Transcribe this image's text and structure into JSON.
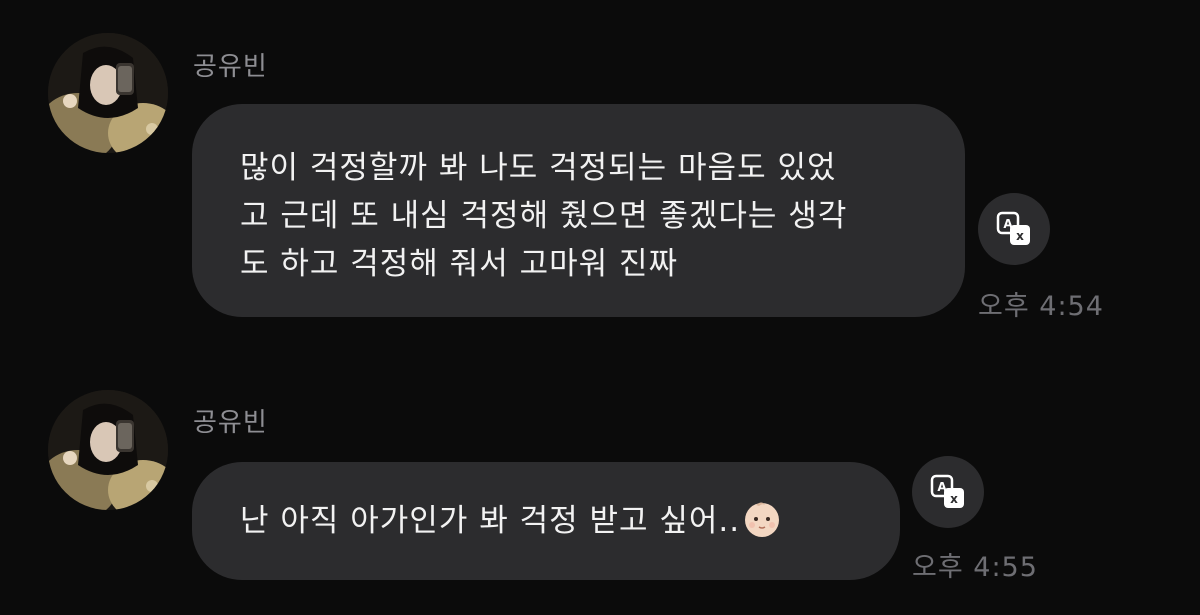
{
  "messages": [
    {
      "sender": "공유빈",
      "lines": [
        "많이 걱정할까 봐 나도 걱정되는 마음도 있었",
        "고 근데 또 내심 걱정해 줬으면 좋겠다는 생각",
        "도 하고 걱정해 줘서 고마워 진짜"
      ],
      "time": "오후 4:54"
    },
    {
      "sender": "공유빈",
      "text": "난 아직 아가인가 봐 걱정 받고 싶어..",
      "emoji": "baby-face-emoji",
      "time": "오후 4:55"
    }
  ],
  "icons": {
    "avatar": "profile-photo",
    "translate": "translate-icon"
  },
  "colors": {
    "background": "#0b0b0b",
    "bubble": "#2c2c2e",
    "text": "#f2f2f2",
    "meta": "#8e8e93"
  }
}
